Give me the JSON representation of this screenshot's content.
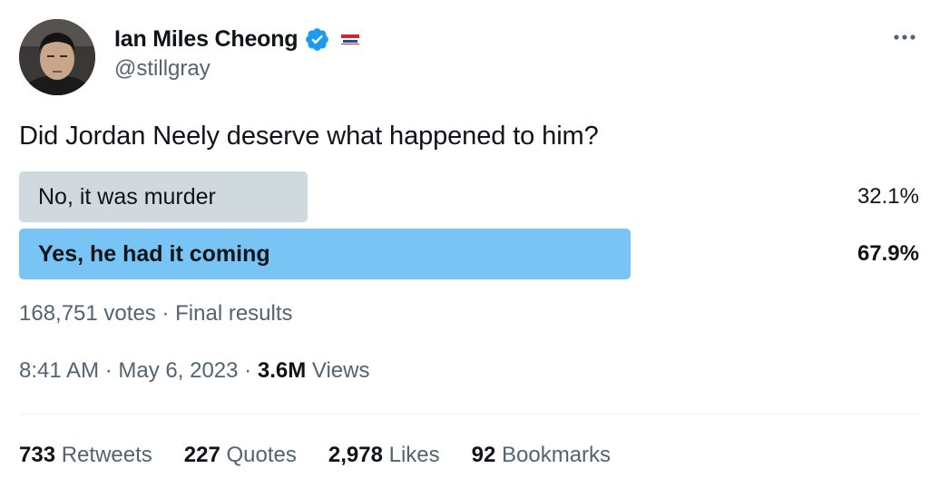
{
  "author": {
    "display_name": "Ian Miles Cheong",
    "handle": "@stillgray",
    "verified": true,
    "avatar_icon": "avatar-photo",
    "affiliate_badge_icon": "media-news-logo"
  },
  "menu": {
    "more_icon": "more-horizontal-icon"
  },
  "tweet": {
    "text": "Did Jordan Neely deserve what happened to him?"
  },
  "poll": {
    "options": [
      {
        "label": "No, it was murder",
        "percent": "32.1%",
        "share": 0.321,
        "winner": false
      },
      {
        "label": "Yes, he had it coming",
        "percent": "67.9%",
        "share": 0.679,
        "winner": true
      }
    ],
    "votes_text": "168,751 votes",
    "separator": "·",
    "status_text": "Final results"
  },
  "meta": {
    "time": "8:41 AM",
    "date": "May 6, 2023",
    "separator": "·",
    "views_count": "3.6M",
    "views_label": "Views"
  },
  "stats": {
    "retweets": {
      "count": "733",
      "label": "Retweets"
    },
    "quotes": {
      "count": "227",
      "label": "Quotes"
    },
    "likes": {
      "count": "2,978",
      "label": "Likes"
    },
    "bookmarks": {
      "count": "92",
      "label": "Bookmarks"
    }
  },
  "colors": {
    "winner_bar": "#78c4f5",
    "loser_bar": "#cfd9de",
    "verified_blue": "#1d9bf0",
    "secondary_text": "#536471",
    "primary_text": "#0f1419"
  }
}
